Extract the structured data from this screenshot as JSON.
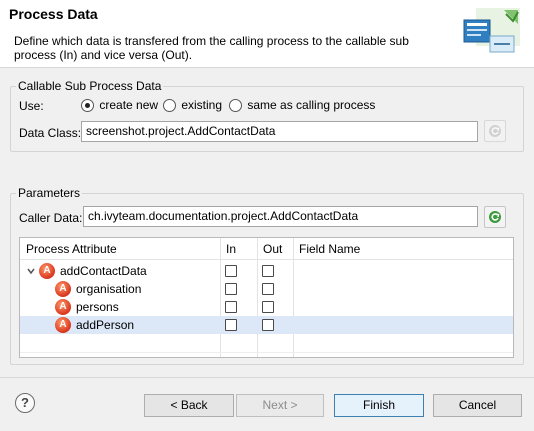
{
  "header": {
    "title": "Process Data",
    "description": "Define which data is transfered from the calling process to the callable sub process (In) and vice versa (Out)."
  },
  "callable_group": {
    "label": "Callable Sub Process Data",
    "use_label": "Use:",
    "options": [
      {
        "label": "create new",
        "checked": true
      },
      {
        "label": "existing",
        "checked": false
      },
      {
        "label": "same as calling process",
        "checked": false
      }
    ],
    "data_class_label": "Data Class:",
    "data_class_value": "screenshot.project.AddContactData"
  },
  "parameters_group": {
    "label": "Parameters",
    "caller_data_label": "Caller Data:",
    "caller_data_value": "ch.ivyteam.documentation.project.AddContactData"
  },
  "table": {
    "columns": [
      "Process Attribute",
      "In",
      "Out",
      "Field Name"
    ],
    "rows": [
      {
        "name": "addContactData",
        "in": false,
        "out": false,
        "expanded": true,
        "level": 0,
        "selected": false
      },
      {
        "name": "organisation",
        "in": false,
        "out": false,
        "level": 1,
        "selected": false
      },
      {
        "name": "persons",
        "in": false,
        "out": false,
        "level": 1,
        "selected": false
      },
      {
        "name": "addPerson",
        "in": false,
        "out": false,
        "level": 1,
        "selected": true
      }
    ]
  },
  "footer": {
    "help": "?",
    "back": "< Back",
    "next": "Next >",
    "finish": "Finish",
    "cancel": "Cancel"
  }
}
